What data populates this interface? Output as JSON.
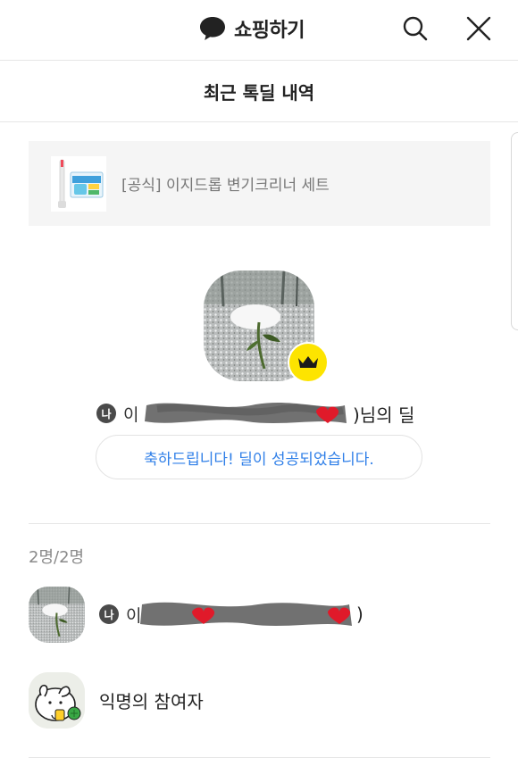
{
  "header": {
    "title": "쇼핑하기",
    "icons": {
      "brand": "speech-bubble-icon",
      "search": "search-icon",
      "close": "close-icon"
    }
  },
  "subheader": {
    "title": "최근 톡딜 내역"
  },
  "product": {
    "name": "[공식] 이지드롭 변기크리너 세트"
  },
  "host": {
    "me_badge": "나",
    "name_redacted": "이",
    "suffix": ")님의 딜",
    "crown_icon": "crown-icon",
    "congrats": "축하드립니다! 딜이 성공되었습니다."
  },
  "participants": {
    "count": "2명/2명",
    "list": [
      {
        "me_badge": "나",
        "name_redacted": "이",
        "suffix": ")"
      },
      {
        "name": "익명의 참여자"
      }
    ]
  },
  "colors": {
    "accent_blue": "#2f7fe8",
    "crown_yellow": "#fde400",
    "badge_dark": "#4a4a4a"
  }
}
